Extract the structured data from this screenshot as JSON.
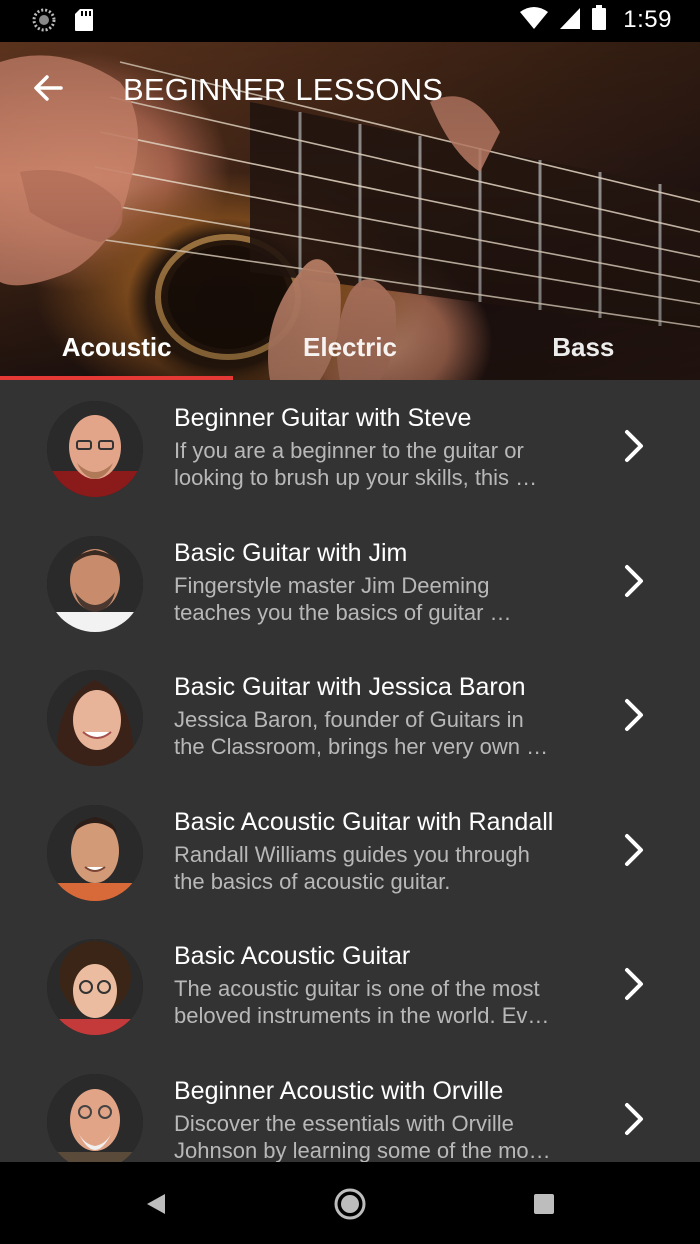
{
  "status_bar": {
    "time": "1:59",
    "left_icons": [
      "sync-icon",
      "sd-card-icon"
    ],
    "right_icons": [
      "wifi-icon",
      "cell-signal-icon",
      "battery-icon"
    ]
  },
  "header": {
    "title": "BEGINNER LESSONS",
    "back_icon": "arrow-back-icon",
    "tabs": [
      {
        "label": "Acoustic",
        "selected": true
      },
      {
        "label": "Electric",
        "selected": false
      },
      {
        "label": "Bass",
        "selected": false
      }
    ],
    "accent_color": "#e53935"
  },
  "lessons": [
    {
      "title": "Beginner Guitar with Steve",
      "desc_line1": "If you are a beginner to the guitar or",
      "desc_line2": "looking to brush up your skills, this …"
    },
    {
      "title": "Basic Guitar with Jim",
      "desc_line1": "Fingerstyle master Jim Deeming",
      "desc_line2": "teaches you the basics of guitar …"
    },
    {
      "title": "Basic Guitar with Jessica Baron",
      "desc_line1": "Jessica Baron, founder of Guitars in",
      "desc_line2": "the Classroom, brings her very own …"
    },
    {
      "title": "Basic Acoustic Guitar with Randall",
      "desc_line1": "Randall Williams guides you through",
      "desc_line2": "the basics of acoustic guitar."
    },
    {
      "title": "Basic Acoustic Guitar",
      "desc_line1": "The acoustic guitar is one of the most",
      "desc_line2": "beloved instruments in the world.  Ev…"
    },
    {
      "title": "Beginner Acoustic with Orville",
      "desc_line1": "Discover the essentials with Orville",
      "desc_line2": "Johnson by learning some of the mo…"
    }
  ],
  "nav_bar": {
    "icons": [
      "back-triangle-icon",
      "home-circle-icon",
      "recents-square-icon"
    ]
  }
}
